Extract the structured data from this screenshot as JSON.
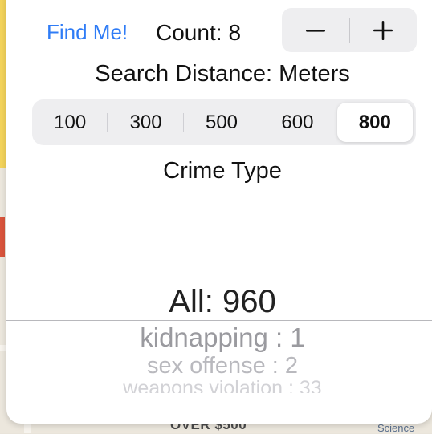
{
  "header": {
    "find_me_label": "Find Me!",
    "count_label": "Count:",
    "count_value": "8",
    "stepper": {
      "decrement_icon": "minus-icon",
      "increment_icon": "plus-icon"
    }
  },
  "search_distance": {
    "label": "Search Distance: Meters",
    "options": [
      "100",
      "300",
      "500",
      "600",
      "800"
    ],
    "selected": "800"
  },
  "crime_type": {
    "label": "Crime Type",
    "picker": {
      "selected": "All: 960",
      "items": [
        "kidnapping : 1",
        "sex offense : 2",
        "weapons violation : 33"
      ]
    }
  },
  "map": {
    "label": "OVER $500",
    "partial_label": "Science"
  },
  "colors": {
    "accent": "#2f7cf6",
    "panel": "#ffffff",
    "segment_bg": "#eeeef0"
  }
}
